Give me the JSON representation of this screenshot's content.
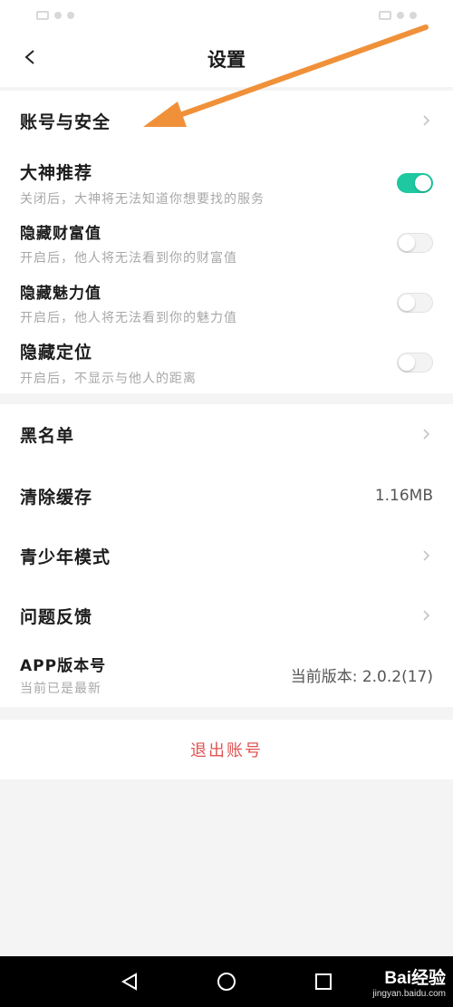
{
  "header": {
    "back_symbol": "<",
    "title": "设置"
  },
  "section_account": {
    "label": "账号与安全"
  },
  "toggles": [
    {
      "title": "大神推荐",
      "subtitle": "关闭后，大神将无法知道你想要找的服务",
      "on": true
    },
    {
      "title": "隐藏财富值",
      "subtitle": "开启后，他人将无法看到你的财富值",
      "on": false
    },
    {
      "title": "隐藏魅力值",
      "subtitle": "开启后，他人将无法看到你的魅力值",
      "on": false
    },
    {
      "title": "隐藏定位",
      "subtitle": "开启后，不显示与他人的距离",
      "on": false
    }
  ],
  "list": {
    "blacklist": {
      "label": "黑名单"
    },
    "cache": {
      "label": "清除缓存",
      "value": "1.16MB"
    },
    "youth_mode": {
      "label": "青少年模式"
    },
    "feedback": {
      "label": "问题反馈"
    },
    "version": {
      "label": "APP版本号",
      "subtitle": "当前已是最新",
      "value": "当前版本: 2.0.2(17)"
    }
  },
  "logout": {
    "label": "退出账号"
  },
  "watermark": {
    "main": "Bai经验",
    "sub": "jingyan.baidu.com"
  },
  "colors": {
    "toggle_on": "#1ec8a0",
    "logout_text": "#e05454",
    "annotation_arrow": "#f0913a"
  },
  "icons": {
    "back": "chevron-left-icon",
    "row": "chevron-right-icon",
    "nav": [
      "back-triangle-icon",
      "home-circle-icon",
      "recents-square-icon"
    ]
  }
}
